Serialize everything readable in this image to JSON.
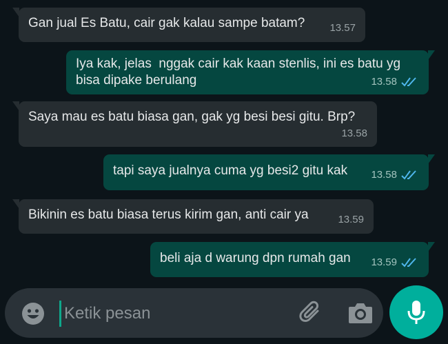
{
  "messages": [
    {
      "direction": "incoming",
      "text": "Gan jual Es Batu, cair gak kalau sampe batam?",
      "time": "13.57"
    },
    {
      "direction": "outgoing",
      "text": "Iya kak, jelas  nggak cair kak kaan stenlis, ini es batu yg bisa dipake berulang",
      "time": "13.58",
      "status": "read"
    },
    {
      "direction": "incoming",
      "text": "Saya mau es batu biasa gan, gak yg besi besi gitu. Brp?",
      "time": "13.58"
    },
    {
      "direction": "outgoing",
      "text": "tapi saya jualnya cuma yg besi2 gitu kak",
      "time": "13.58",
      "status": "read"
    },
    {
      "direction": "incoming",
      "text": "Bikinin es batu biasa terus kirim gan, anti cair ya",
      "time": "13.59"
    },
    {
      "direction": "outgoing",
      "text": "beli aja d warung dpn rumah gan",
      "time": "13.59",
      "status": "read"
    }
  ],
  "composer": {
    "placeholder": "Ketik pesan",
    "value": "",
    "icons": {
      "emoji": "emoji-icon",
      "attach": "paperclip-icon",
      "camera": "camera-icon",
      "send": "microphone-icon"
    }
  },
  "colors": {
    "background": "#0c1419",
    "incoming_bubble": "#262d31",
    "outgoing_bubble": "#054740",
    "read_ticks": "#4fb6ec",
    "accent": "#00af9c"
  }
}
